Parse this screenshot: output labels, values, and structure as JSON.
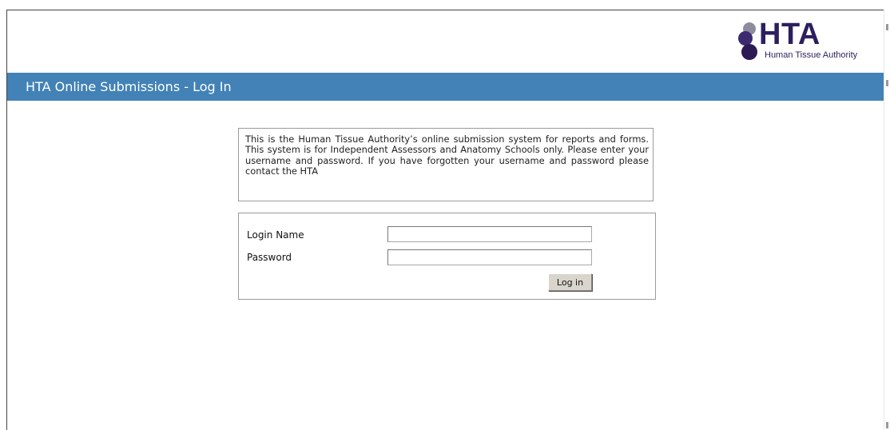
{
  "logo": {
    "wordmark": "HTA",
    "subtitle": "Human Tissue Authority",
    "colors": {
      "dark": "#2c1a54",
      "mid": "#3b2a6f",
      "light": "#8d8c9d"
    }
  },
  "header": {
    "title": "HTA Online Submissions - Log In",
    "bar_color": "#4282b6"
  },
  "intro": {
    "text": "This is the Human Tissue Authority’s online submission system for reports and forms. This system is for Independent Assessors and Anatomy Schools only. Please enter your username and password. If you have forgotten your username and password please contact the HTA"
  },
  "login_form": {
    "login_name_label": "Login Name",
    "login_name_value": "",
    "password_label": "Password",
    "password_value": "",
    "submit_label": "Log in"
  }
}
